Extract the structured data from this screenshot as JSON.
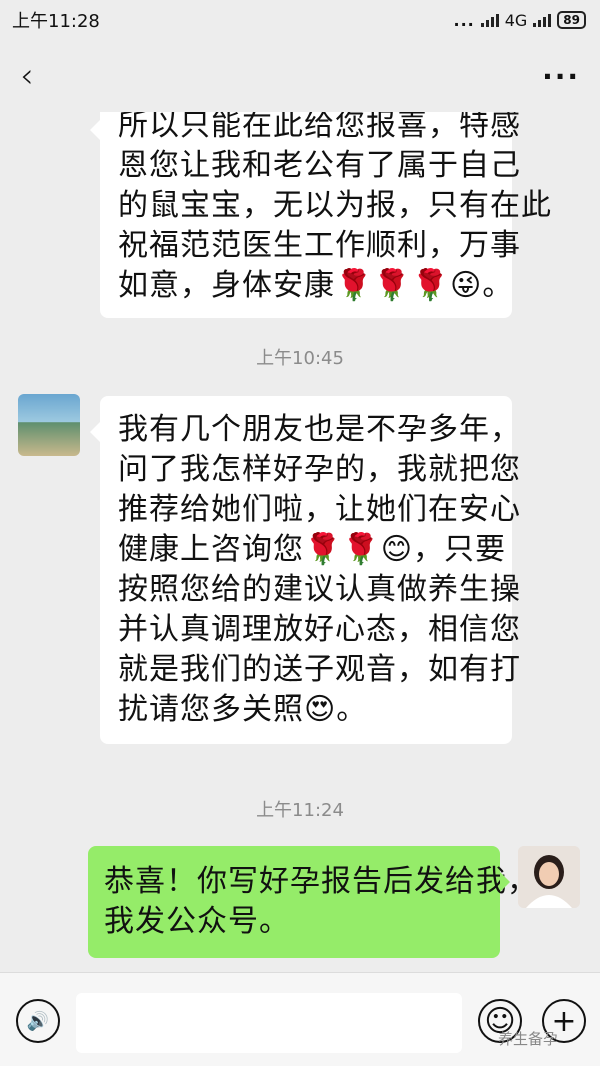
{
  "status_bar": {
    "time": "上午11:28",
    "signal_dots": "...",
    "network": "4G",
    "battery": "89"
  },
  "nav": {
    "back_icon": "chevron-left-icon",
    "more_icon": "more-icon",
    "more_glyph": "···"
  },
  "messages": [
    {
      "side": "left",
      "lines": [
        "所以只能在此给您报喜，特感",
        "恩您让我和老公有了属于自己",
        "的鼠宝宝，无以为报，只有在此",
        "祝福范范医生工作顺利，万事",
        "如意，身体安康🌹🌹🌹😜。"
      ]
    },
    {
      "side": "left",
      "lines": [
        "我有几个朋友也是不孕多年，",
        "问了我怎样好孕的，我就把您",
        "推荐给她们啦，让她们在安心",
        "健康上咨询您🌹🌹😊，只要",
        "按照您给的建议认真做养生操",
        "并认真调理放好心态，相信您",
        "就是我们的送子观音，如有打",
        "扰请您多关照😍。"
      ]
    },
    {
      "side": "right",
      "lines": [
        "恭喜！你写好孕报告后发给我，",
        "我发公众号。"
      ]
    }
  ],
  "timestamps": [
    "上午10:45",
    "上午11:24"
  ],
  "bottom_bar": {
    "voice_icon": "voice-icon",
    "emoji_icon": "emoji-icon",
    "plus_icon": "plus-icon",
    "voice_glyph": "🔊",
    "emoji_glyph": "☺",
    "plus_glyph": "+"
  },
  "watermark": "养生备孕"
}
